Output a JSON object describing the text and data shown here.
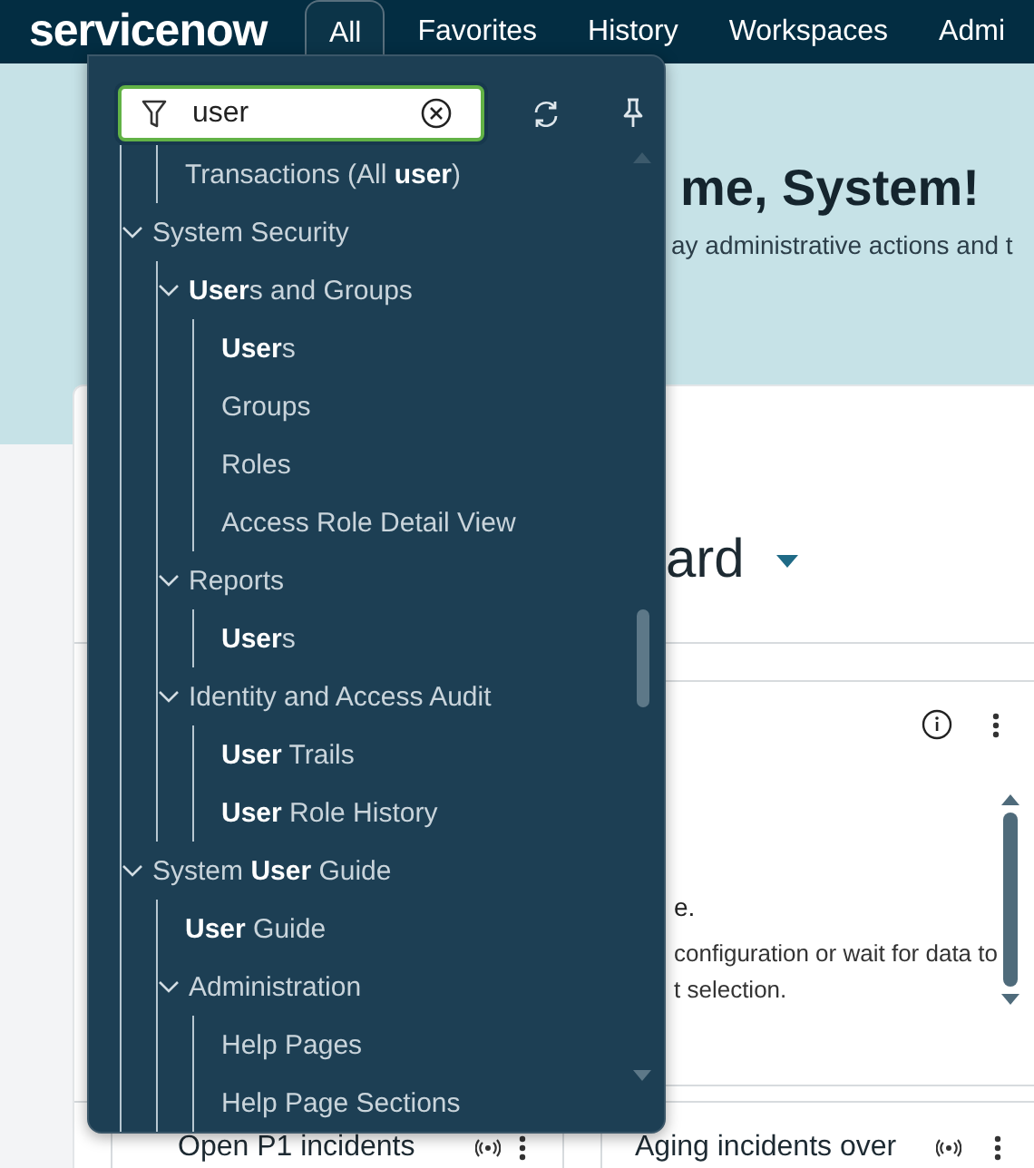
{
  "header": {
    "logo": "servicenow",
    "tabs": [
      {
        "label": "All",
        "selected": true
      },
      {
        "label": "Favorites",
        "selected": false
      },
      {
        "label": "History",
        "selected": false
      },
      {
        "label": "Workspaces",
        "selected": false
      },
      {
        "label": "Admi",
        "selected": false
      }
    ]
  },
  "hero": {
    "heading": "me, System!",
    "subtitle": "ay administrative actions and t"
  },
  "dashboard": {
    "title": "ard",
    "widgets": [
      {
        "texts": [
          "e.",
          "configuration or wait for data to",
          "t selection."
        ]
      }
    ],
    "bottom_widgets": [
      {
        "title": "Open P1 incidents"
      },
      {
        "title": "Aging incidents over"
      }
    ]
  },
  "menu": {
    "search": {
      "value": "user"
    },
    "items": [
      {
        "children": [
          {
            "label": "Transactions (All **user**)"
          }
        ]
      },
      {
        "label": "System Security",
        "expanded": true,
        "children": [
          {
            "label": "**User**s and Groups",
            "expanded": true,
            "children": [
              {
                "label": "**User**s"
              },
              {
                "label": "Groups"
              },
              {
                "label": "Roles"
              },
              {
                "label": "Access Role Detail View"
              }
            ]
          },
          {
            "label": "Reports",
            "expanded": true,
            "children": [
              {
                "label": "**User**s"
              }
            ]
          },
          {
            "label": "Identity and Access Audit",
            "expanded": true,
            "children": [
              {
                "label": "**User** Trails"
              },
              {
                "label": "**User** Role History"
              }
            ]
          }
        ]
      },
      {
        "label": "System **User** Guide",
        "expanded": true,
        "children": [
          {
            "label": "**User** Guide"
          },
          {
            "label": "Administration",
            "expanded": true,
            "children": [
              {
                "label": "Help Pages"
              },
              {
                "label": "Help Page Sections"
              }
            ]
          }
        ]
      }
    ]
  }
}
